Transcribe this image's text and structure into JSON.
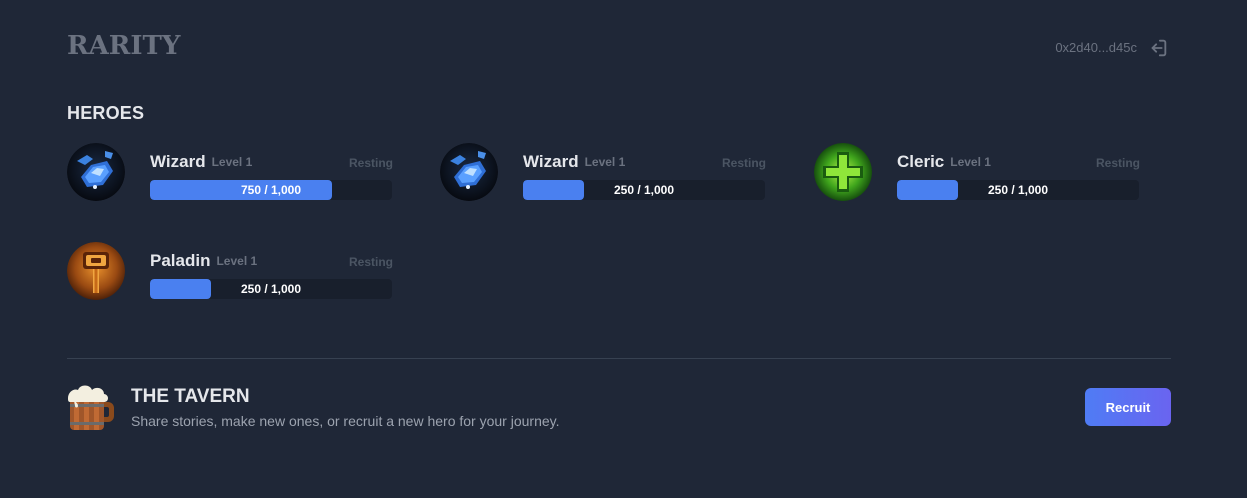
{
  "header": {
    "logo": "RARITY",
    "account": "0x2d40...d45c",
    "logout_icon": "logout-icon"
  },
  "heroes_section": {
    "title": "HEROES",
    "heroes": [
      {
        "name": "Wizard",
        "level": "Level 1",
        "status": "Resting",
        "xp_text": "750 / 1,000",
        "xp": 750,
        "xp_max": 1000,
        "icon": "wizard-crystal-icon"
      },
      {
        "name": "Wizard",
        "level": "Level 1",
        "status": "Resting",
        "xp_text": "250 / 1,000",
        "xp": 250,
        "xp_max": 1000,
        "icon": "wizard-crystal-icon"
      },
      {
        "name": "Cleric",
        "level": "Level 1",
        "status": "Resting",
        "xp_text": "250 / 1,000",
        "xp": 250,
        "xp_max": 1000,
        "icon": "cleric-cross-icon"
      },
      {
        "name": "Paladin",
        "level": "Level 1",
        "status": "Resting",
        "xp_text": "250 / 1,000",
        "xp": 250,
        "xp_max": 1000,
        "icon": "paladin-hammer-icon"
      }
    ]
  },
  "tavern": {
    "title": "THE TAVERN",
    "description": "Share stories, make new ones, or recruit a new hero for your journey.",
    "button_label": "Recruit",
    "icon": "beer-mug-icon"
  },
  "colors": {
    "background": "#1f2737",
    "accent": "#4a80f0",
    "button_gradient_end": "#6a64f0"
  }
}
